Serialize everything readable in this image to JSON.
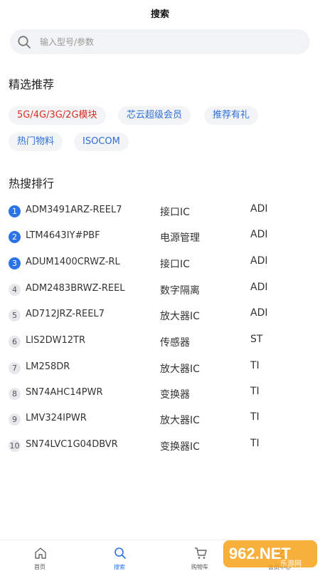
{
  "header": {
    "title": "搜索"
  },
  "search": {
    "placeholder": "输入型号/参数"
  },
  "featured": {
    "title": "精选推荐",
    "tags": [
      {
        "label": "5G/4G/3G/2G模块",
        "color": "#d93024"
      },
      {
        "label": "芯云超级会员",
        "color": "#2f6fd8"
      },
      {
        "label": "推荐有礼",
        "color": "#2f6fd8"
      },
      {
        "label": "热门物料",
        "color": "#2f6fd8"
      },
      {
        "label": "ISOCOM",
        "color": "#2f6fd8"
      }
    ]
  },
  "hot": {
    "title": "热搜排行",
    "rows": [
      {
        "rank": "1",
        "model": "ADM3491ARZ-REEL7",
        "category": "接口IC",
        "brand": "ADI"
      },
      {
        "rank": "2",
        "model": "LTM4643IY#PBF",
        "category": "电源管理",
        "brand": "ADI"
      },
      {
        "rank": "3",
        "model": "ADUM1400CRWZ-RL",
        "category": "接口IC",
        "brand": "ADI"
      },
      {
        "rank": "4",
        "model": "ADM2483BRWZ-REEL",
        "category": "数字隔离",
        "brand": "ADI"
      },
      {
        "rank": "5",
        "model": "AD712JRZ-REEL7",
        "category": "放大器IC",
        "brand": "ADI"
      },
      {
        "rank": "6",
        "model": "LIS2DW12TR",
        "category": "传感器",
        "brand": "ST"
      },
      {
        "rank": "7",
        "model": "LM258DR",
        "category": "放大器IC",
        "brand": "TI"
      },
      {
        "rank": "8",
        "model": "SN74AHC14PWR",
        "category": "变换器",
        "brand": "TI"
      },
      {
        "rank": "9",
        "model": "LMV324IPWR",
        "category": "放大器IC",
        "brand": "TI"
      },
      {
        "rank": "10",
        "model": "SN74LVC1G04DBVR",
        "category": "变换器IC",
        "brand": "TI"
      }
    ]
  },
  "tabbar": {
    "tabs": [
      {
        "label": "首页",
        "icon": "home-icon"
      },
      {
        "label": "搜索",
        "icon": "search-icon"
      },
      {
        "label": "购物车",
        "icon": "cart-icon"
      },
      {
        "label": "会员中心",
        "icon": "user-icon"
      }
    ]
  },
  "watermark": {
    "text": "962.NET",
    "sub": "乐游网"
  },
  "colors": {
    "accent": "#2b73e6",
    "hot_tag": "#d93024",
    "tag_text": "#2f6fd8",
    "tag_bg": "#f3f4f6"
  }
}
